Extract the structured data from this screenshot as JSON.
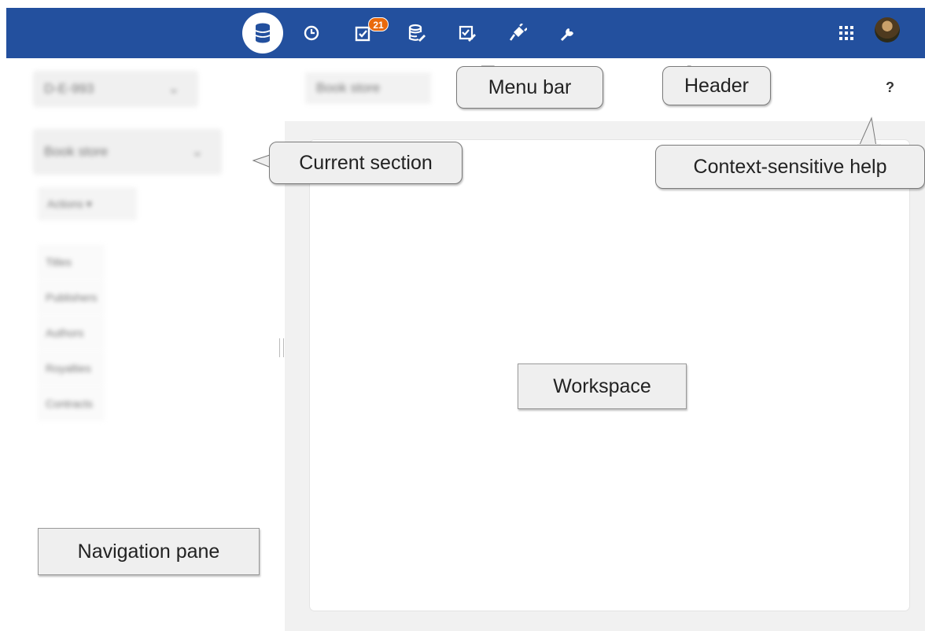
{
  "header": {
    "menu_icons": [
      "database-icon",
      "clock-icon",
      "tasks-icon",
      "database-edit-icon",
      "review-icon",
      "plugin-icon",
      "wrench-icon"
    ],
    "tasks_badge": "21",
    "apps_icon": "apps-grid-icon",
    "help_label": "?"
  },
  "nav": {
    "database_select": "D-E-993",
    "section_select": "Book store",
    "actions_label": "Actions ▾",
    "items": [
      "Titles",
      "Publishers",
      "Authors",
      "Royalties",
      "Contracts"
    ]
  },
  "breadcrumb": "Book store",
  "callouts": {
    "menu_bar": "Menu bar",
    "header": "Header",
    "current_section": "Current section",
    "context_help": "Context-sensitive help",
    "workspace": "Workspace",
    "navigation_pane": "Navigation pane"
  },
  "colors": {
    "header_bg": "#23509e",
    "badge": "#e9690c"
  }
}
